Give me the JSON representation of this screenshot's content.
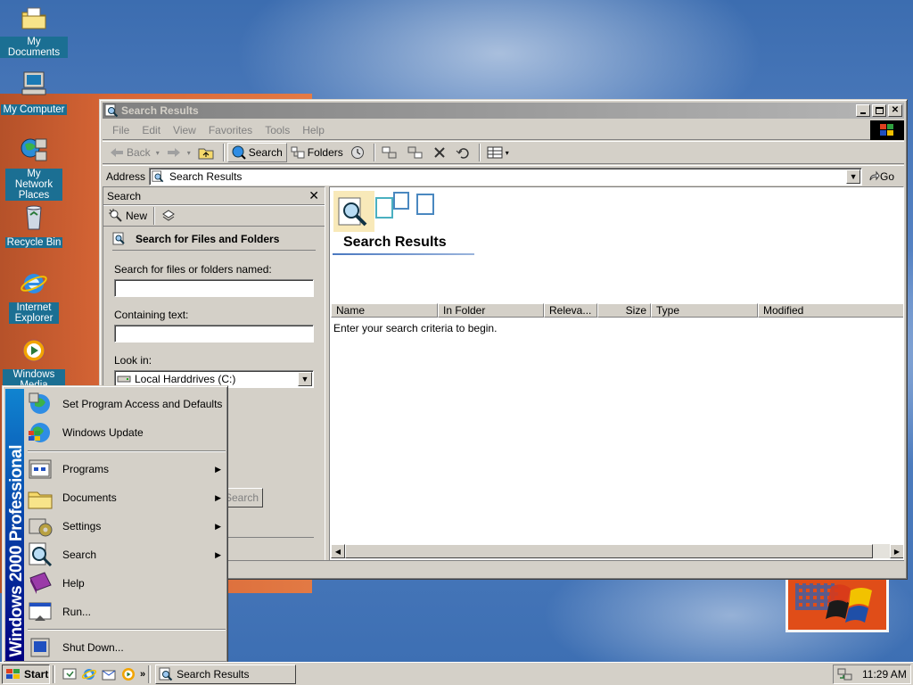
{
  "desktop": {
    "icons": [
      {
        "label": "My Documents",
        "icon": "my-documents-icon"
      },
      {
        "label": "My Computer",
        "icon": "my-computer-icon"
      },
      {
        "label": "My Network Places",
        "icon": "network-places-icon"
      },
      {
        "label": "Recycle Bin",
        "icon": "recycle-bin-icon"
      },
      {
        "label": "Internet Explorer",
        "icon": "internet-explorer-icon"
      },
      {
        "label": "Windows Media Player",
        "icon": "media-player-icon"
      }
    ]
  },
  "window": {
    "title": "Search Results",
    "menu": [
      "File",
      "Edit",
      "View",
      "Favorites",
      "Tools",
      "Help"
    ],
    "toolbar": {
      "back": "Back",
      "search": "Search",
      "folders": "Folders"
    },
    "address": {
      "label": "Address",
      "value": "Search Results",
      "go": "Go"
    },
    "search_pane": {
      "header": "Search",
      "new_label": "New",
      "title": "Search for Files and Folders",
      "named_label": "Search for files or folders named:",
      "named_value": "",
      "containing_label": "Containing text:",
      "containing_value": "",
      "lookin_label": "Look in:",
      "lookin_value": "Local Harddrives (C:)",
      "search_button": "Search"
    },
    "results": {
      "title": "Search Results",
      "columns": [
        "Name",
        "In Folder",
        "Releva...",
        "Size",
        "Type",
        "Modified"
      ],
      "message": "Enter your search criteria to begin."
    }
  },
  "start_menu": {
    "band_text": "Windows 2000 Professional",
    "items": [
      {
        "label": "Set Program Access and Defaults",
        "icon": "program-access-icon",
        "submenu": false
      },
      {
        "label": "Windows Update",
        "icon": "windows-update-icon",
        "submenu": false
      },
      {
        "label": "Programs",
        "icon": "programs-icon",
        "submenu": true
      },
      {
        "label": "Documents",
        "icon": "documents-icon",
        "submenu": true
      },
      {
        "label": "Settings",
        "icon": "settings-icon",
        "submenu": true
      },
      {
        "label": "Search",
        "icon": "search-icon",
        "submenu": true
      },
      {
        "label": "Help",
        "icon": "help-icon",
        "submenu": false
      },
      {
        "label": "Run...",
        "icon": "run-icon",
        "submenu": false
      },
      {
        "label": "Shut Down...",
        "icon": "shut-down-icon",
        "submenu": false
      }
    ]
  },
  "taskbar": {
    "start_label": "Start",
    "tasks": [
      {
        "label": "Search Results"
      }
    ],
    "clock": "11:29 AM"
  }
}
